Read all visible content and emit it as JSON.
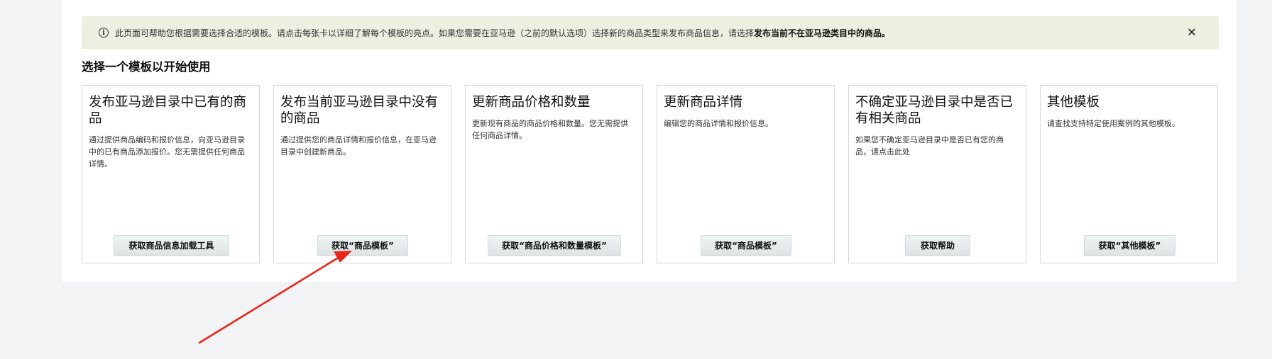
{
  "banner": {
    "text": "此页面可帮助您根据需要选择合适的模板。请点击每张卡以详细了解每个模板的亮点。如果您需要在亚马逊（之前的默认选项）选择新的商品类型来发布商品信息，请选择",
    "bold_text": "发布当前不在亚马逊类目中的商品。",
    "info_icon": "info-icon",
    "close_icon": "close-icon",
    "close_glyph": "✕",
    "background_color": "#ebf0e1"
  },
  "section_title": "选择一个模板以开始使用",
  "cards": [
    {
      "title": "发布亚马逊目录中已有的商品",
      "description": "通过提供商品编码和报价信息，向亚马逊目录中的已有商品添加报价。您无需提供任何商品详情。",
      "button": "获取商品信息加载工具"
    },
    {
      "title": "发布当前亚马逊目录中没有的商品",
      "description": "通过提供您的商品详情和报价信息，在亚马逊目录中创建新商品。",
      "button": "获取“商品模板”"
    },
    {
      "title": "更新商品价格和数量",
      "description": "更新现有商品的商品价格和数量。您无需提供任何商品详情。",
      "button": "获取“商品价格和数量模板”"
    },
    {
      "title": "更新商品详情",
      "description": "编辑您的商品详情和报价信息。",
      "button": "获取“商品模板”"
    },
    {
      "title": "不确定亚马逊目录中是否已有相关商品",
      "description": "如果您不确定亚马逊目录中是否已有您的商品，请点击此处",
      "button": "获取帮助"
    },
    {
      "title": "其他模板",
      "description": "请查找支持特定使用案例的其他模板。",
      "button": "获取“其他模板”"
    }
  ],
  "annotation": {
    "arrow_color": "#e8261c"
  }
}
